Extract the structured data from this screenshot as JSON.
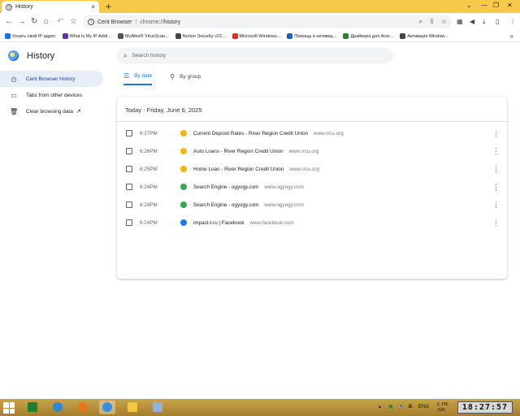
{
  "tab": {
    "title": "History",
    "close": "×"
  },
  "newtab": "+",
  "window": {
    "down": "⌄",
    "minimize": "—",
    "maximize": "❐",
    "close": "✕"
  },
  "omnibox": {
    "app": "Cent Browser",
    "separator": "|",
    "scheme": "chrome://",
    "path": "history"
  },
  "bookmarks": [
    {
      "label": "Узнать свой IP адрес",
      "color": "#1a73e8"
    },
    {
      "label": "What Is My IP Addr...",
      "color": "#6a2fa8"
    },
    {
      "label": "McAfee® VirusScan...",
      "color": "#555555"
    },
    {
      "label": "Norton Security v22...",
      "color": "#444444"
    },
    {
      "label": "Microsoft Windows...",
      "color": "#d93025"
    },
    {
      "label": "Помощь в активац...",
      "color": "#1565c0"
    },
    {
      "label": "Драйвера для Acer...",
      "color": "#2e7d32"
    },
    {
      "label": "Активація Window...",
      "color": "#424242"
    }
  ],
  "page": {
    "title": "History",
    "search_placeholder": "Search history"
  },
  "sidebar": [
    {
      "label": "Cent Browser history",
      "icon": "clock-icon",
      "active": true
    },
    {
      "label": "Tabs from other devices",
      "icon": "devices-icon",
      "active": false
    },
    {
      "label": "Clear browsing data",
      "icon": "trash-icon",
      "active": false
    }
  ],
  "tabs": [
    {
      "label": "By date",
      "selected": true
    },
    {
      "label": "By group",
      "selected": false
    }
  ],
  "history": {
    "date_label": "Today - Friday, June 6, 2025",
    "rows": [
      {
        "time": "6:27PM",
        "title": "Current Deposit Rates - River Region Credit Union",
        "domain": "www.rrcu.org",
        "favicon_color": "#f2b705"
      },
      {
        "time": "6:26PM",
        "title": "Auto Loans - River Region Credit Union",
        "domain": "www.rrcu.org",
        "favicon_color": "#f2b705"
      },
      {
        "time": "6:25PM",
        "title": "Home Loan - River Region Credit Union",
        "domain": "www.rrcu.org",
        "favicon_color": "#f2b705"
      },
      {
        "time": "6:24PM",
        "title": "Search Engine - ogyogy.com",
        "domain": "www.ogyogy.com",
        "favicon_color": "#34a853"
      },
      {
        "time": "6:24PM",
        "title": "Search Engine - ogyogy.com",
        "domain": "www.ogyogy.com",
        "favicon_color": "#34a853"
      },
      {
        "time": "6:24PM",
        "title": "impact-t.ru | Facebook",
        "domain": "www.facebook.com",
        "favicon_color": "#1877f2"
      }
    ]
  },
  "taskbar": {
    "lang": "ENG",
    "date_small": "6, FRI JUN",
    "clock": "18:27:57"
  }
}
